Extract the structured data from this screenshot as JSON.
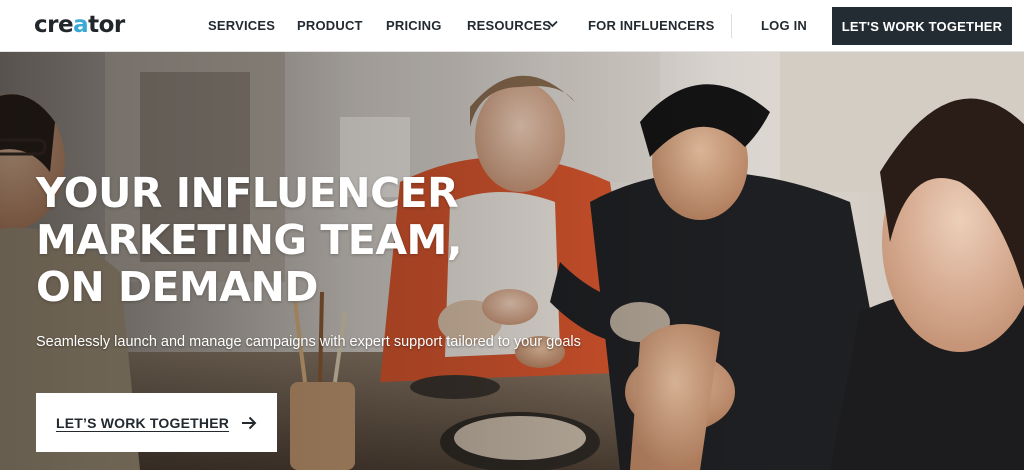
{
  "header": {
    "logo_text_a": "cre",
    "logo_text_b": "a",
    "logo_text_c": "tor",
    "nav": {
      "services": "SERVICES",
      "product": "PRODUCT",
      "pricing": "PRICING",
      "resources": "RESOURCES",
      "influencers": "FOR INFLUENCERS",
      "login": "LOG IN"
    },
    "cta_label": "LET'S WORK TOGETHER",
    "resources_icon": "chevron-down-icon"
  },
  "hero": {
    "title_lines": [
      "YOUR INFLUENCER",
      "MARKETING TEAM,",
      "ON DEMAND"
    ],
    "subtitle": "Seamlessly launch and manage campaigns with expert support tailored to your goals",
    "cta_label": "LET’S WORK TOGETHER",
    "cta_icon": "arrow-right-icon",
    "image_subject": "people-at-pottery-workshop-photo"
  },
  "colors": {
    "brand_dark": "#232c33",
    "logo_accent": "#3ba9d3",
    "text_dark": "#232a30",
    "white": "#ffffff"
  }
}
